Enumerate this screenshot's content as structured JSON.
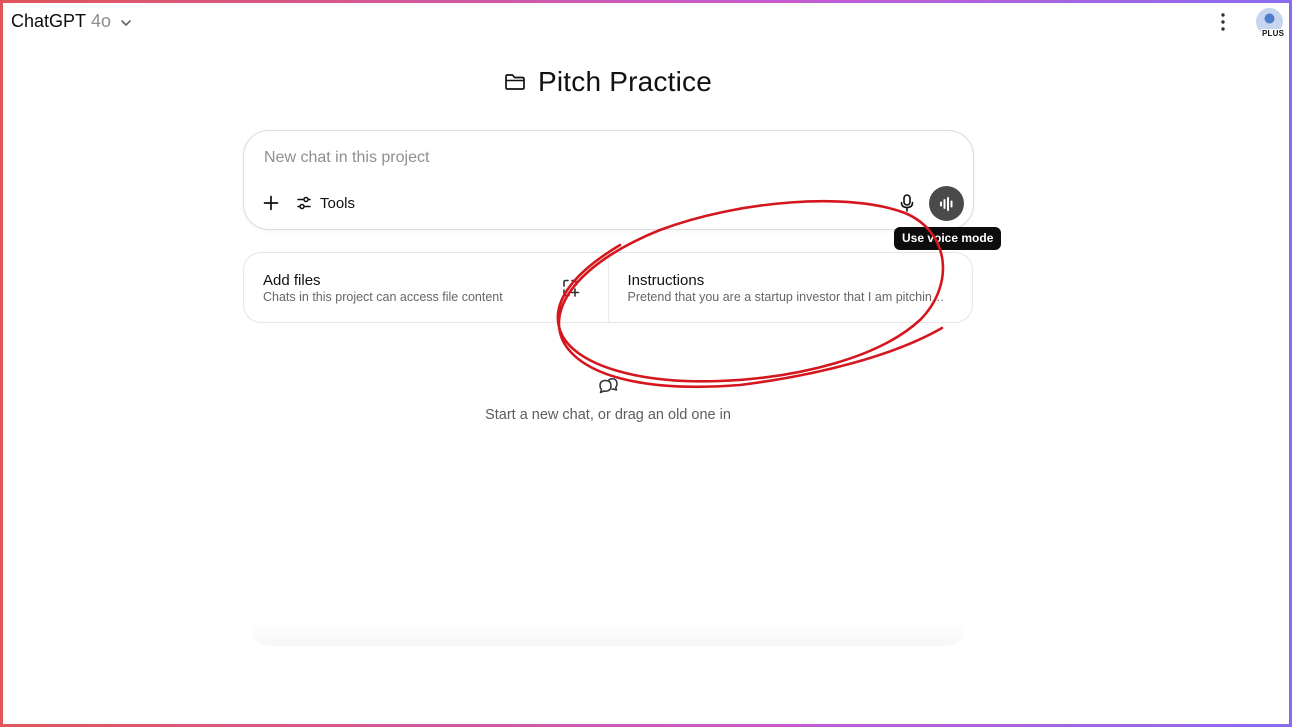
{
  "header": {
    "model_name": "ChatGPT",
    "model_version": "4o",
    "plan_badge": "PLUS"
  },
  "project": {
    "title": "Pitch Practice"
  },
  "composer": {
    "placeholder": "New chat in this project",
    "tools_label": "Tools",
    "voice_tooltip": "Use voice mode"
  },
  "cards": {
    "files": {
      "title": "Add files",
      "description": "Chats in this project can access file content"
    },
    "instructions": {
      "title": "Instructions",
      "description": "Pretend that you are a startup investor that I am pitching t..."
    }
  },
  "empty_state": {
    "text": "Start a new chat, or drag an old one in"
  },
  "colors": {
    "annotation": "#d4171e",
    "voice_button": "#4a4a4a",
    "tooltip_bg": "#0d0d0d"
  },
  "icons": [
    "chevron-down-icon",
    "more-vertical-icon",
    "folder-icon",
    "plus-icon",
    "tools-sliders-icon",
    "microphone-icon",
    "voice-wave-icon",
    "add-file-icon",
    "chat-bubbles-icon"
  ]
}
